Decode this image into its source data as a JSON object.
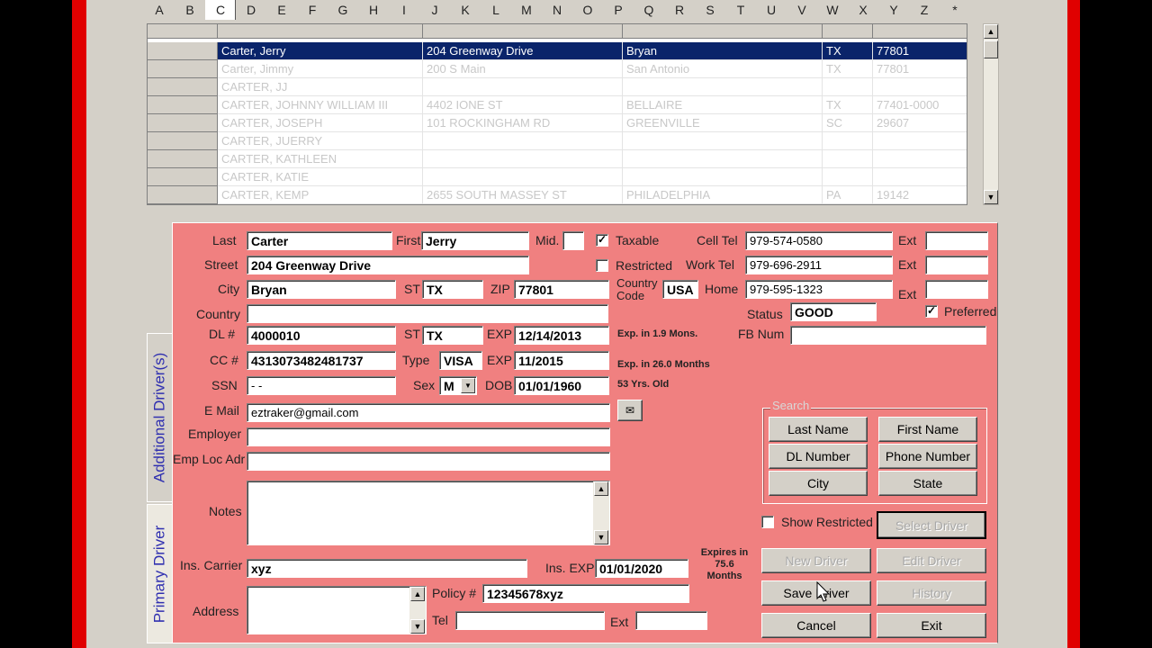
{
  "alphabet": [
    "A",
    "B",
    "C",
    "D",
    "E",
    "F",
    "G",
    "H",
    "I",
    "J",
    "K",
    "L",
    "M",
    "N",
    "O",
    "P",
    "Q",
    "R",
    "S",
    "T",
    "U",
    "V",
    "W",
    "X",
    "Y",
    "Z",
    "*"
  ],
  "alphabet_active": "C",
  "grid": {
    "rows": [
      {
        "name": "Carter, Jerry",
        "street": "204 Greenway Drive",
        "city": "Bryan",
        "st": "TX",
        "zip": "77801"
      },
      {
        "name": "Carter, Jimmy",
        "street": "200 S Main",
        "city": "San Antonio",
        "st": "TX",
        "zip": "77801"
      },
      {
        "name": "CARTER, JJ",
        "street": "",
        "city": "",
        "st": "",
        "zip": ""
      },
      {
        "name": "CARTER, JOHNNY WILLIAM III",
        "street": "4402 IONE ST",
        "city": "BELLAIRE",
        "st": "TX",
        "zip": "77401-0000"
      },
      {
        "name": "CARTER, JOSEPH",
        "street": "101 ROCKINGHAM RD",
        "city": "GREENVILLE",
        "st": "SC",
        "zip": "29607"
      },
      {
        "name": "CARTER, JUERRY",
        "street": "",
        "city": "",
        "st": "",
        "zip": ""
      },
      {
        "name": "CARTER, KATHLEEN",
        "street": "",
        "city": "",
        "st": "",
        "zip": ""
      },
      {
        "name": "CARTER, KATIE",
        "street": "",
        "city": "",
        "st": "",
        "zip": ""
      },
      {
        "name": "CARTER, KEMP",
        "street": "2655 SOUTH MASSEY ST",
        "city": "PHILADELPHIA",
        "st": "PA",
        "zip": "19142"
      }
    ]
  },
  "tabs": {
    "additional": "Additional Driver(s)",
    "primary": "Primary Driver"
  },
  "form": {
    "last_label": "Last",
    "last": "Carter",
    "first_label": "First",
    "first": "Jerry",
    "mid_label": "Mid.",
    "mid": "",
    "taxable_label": "Taxable",
    "taxable_check": "✓",
    "restricted_label": "Restricted",
    "street_label": "Street",
    "street": "204 Greenway Drive",
    "city_label": "City",
    "city": "Bryan",
    "st_label": "ST",
    "st": "TX",
    "zip_label": "ZIP",
    "zip": "77801",
    "country_code_label1": "Country",
    "country_code_label2": "Code",
    "country_code": "USA",
    "country_label": "Country",
    "country": "",
    "dl_label": "DL #",
    "dl": "4000010",
    "dl_st": "TX",
    "exp_label": "EXP",
    "dl_exp": "12/14/2013",
    "dl_exp_note": "Exp. in 1.9 Mons.",
    "cc_label": "CC #",
    "cc": "4313073482481737",
    "type_label": "Type",
    "cc_type": "VISA",
    "cc_exp": "11/2015",
    "cc_exp_note": "Exp. in 26.0 Months",
    "ssn_label": "SSN",
    "ssn": "  -  -",
    "sex_label": "Sex",
    "sex": "M",
    "dob_label": "DOB",
    "dob": "01/01/1960",
    "age_note": "53 Yrs. Old",
    "email_label": "E Mail",
    "email": "eztraker@gmail.com",
    "employer_label": "Employer",
    "employer": "",
    "emp_loc_label": "Emp Loc Adr",
    "emp_loc": "",
    "notes_label": "Notes",
    "ins_carrier_label": "Ins. Carrier",
    "ins_carrier": "xyz",
    "ins_exp_label": "Ins. EXP",
    "ins_exp": "01/01/2020",
    "ins_note": "Expires in 75.6 Months",
    "address_label": "Address",
    "policy_label": "Policy #",
    "policy": "12345678xyz",
    "tel_label": "Tel",
    "tel": "",
    "ext_label": "Ext",
    "cell_label": "Cell Tel",
    "cell": "979-574-0580",
    "work_label": "Work Tel",
    "work": "979-696-2911",
    "home_label": "Home",
    "home": "979-595-1323",
    "status_label": "Status",
    "status": "GOOD",
    "preferred_label": "Preferred",
    "preferred_check": "✓",
    "fb_label": "FB Num",
    "fb": ""
  },
  "search": {
    "label": "Search",
    "last_name": "Last Name",
    "first_name": "First Name",
    "dl_number": "DL Number",
    "phone_number": "Phone Number",
    "city": "City",
    "state": "State"
  },
  "actions": {
    "show_restricted": "Show Restricted",
    "select_driver": "Select Driver",
    "new_driver": "New Driver",
    "edit_driver": "Edit Driver",
    "save_driver": "Save Driver",
    "history": "History",
    "cancel": "Cancel",
    "exit": "Exit"
  },
  "colors": {
    "panel": "#f08080",
    "selection": "#0a246a",
    "frame": "#e00000"
  }
}
